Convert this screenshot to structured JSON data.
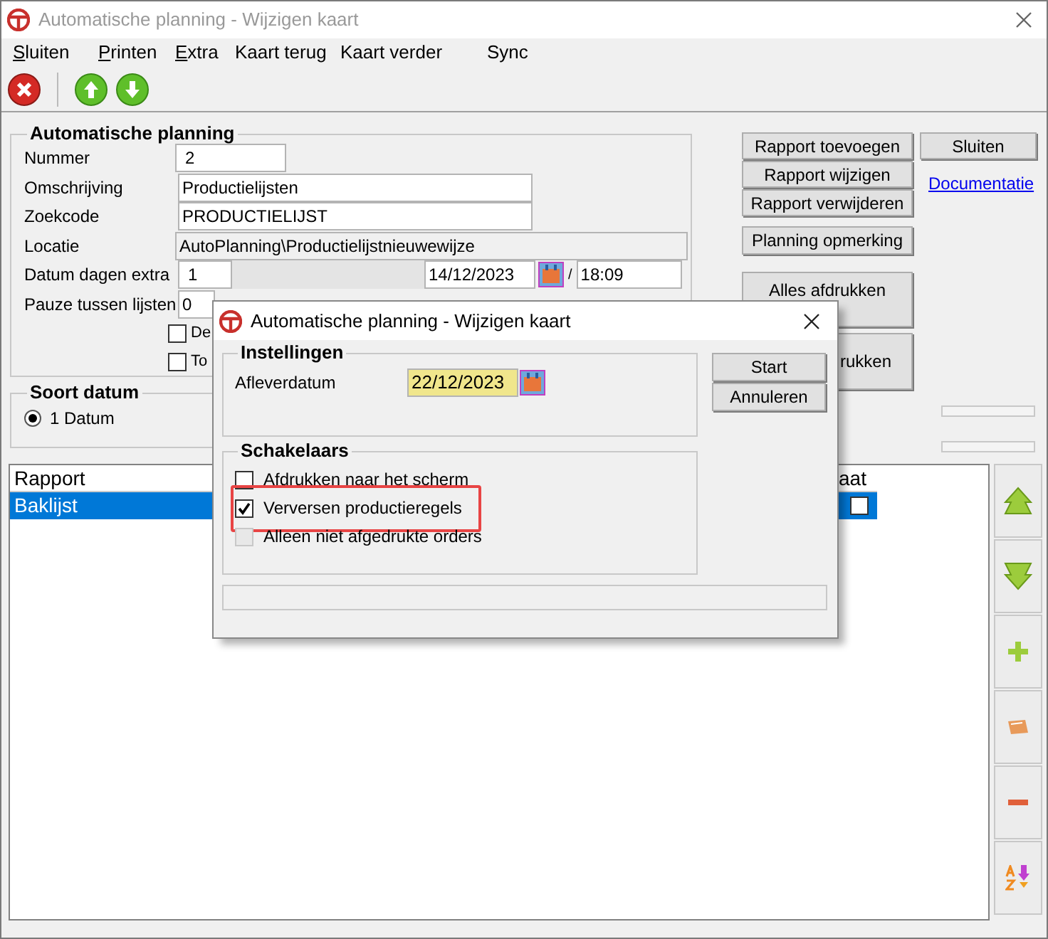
{
  "window": {
    "title": "Automatische planning - Wijzigen kaart"
  },
  "menu": [
    {
      "label": "Sluiten",
      "mnemonic": true
    },
    {
      "label": "Printen",
      "mnemonic": true
    },
    {
      "label": "Extra",
      "mnemonic": true
    },
    {
      "label": "Kaart terug",
      "mnemonic": false
    },
    {
      "label": "Kaart verder",
      "mnemonic": false
    },
    {
      "label": "Sync",
      "mnemonic": false
    }
  ],
  "form": {
    "title": "Automatische planning",
    "fields": [
      {
        "label": "Nummer",
        "value": "2",
        "kind": "short"
      },
      {
        "label": "Omschrijving",
        "value": "Productielijsten",
        "kind": "long"
      },
      {
        "label": "Zoekcode",
        "value": "PRODUCTIELIJST",
        "kind": "long"
      },
      {
        "label": "Locatie",
        "value": "AutoPlanning\\Productielijstnieuwewijze",
        "kind": "readonly"
      },
      {
        "label": "Datum dagen extra",
        "value": "1",
        "kind": "datetime",
        "date": "14/12/2023",
        "separator": "/",
        "time": "18:09"
      },
      {
        "label": "Pauze tussen lijsten",
        "value": "0",
        "kind": "tiny"
      }
    ],
    "checkboxes": [
      {
        "label": "De",
        "checked": false
      },
      {
        "label": "To",
        "checked": false
      }
    ]
  },
  "soort_datum": {
    "title": "Soort datum",
    "options": [
      {
        "label": "1 Datum",
        "selected": true
      }
    ]
  },
  "actions": [
    "Rapport toevoegen",
    "Rapport wijzigen",
    "Rapport verwijderen",
    "Planning opmerking",
    "Alles afdrukken",
    "rukken"
  ],
  "progress": [
    {
      "level": 0
    },
    {
      "level": 0
    }
  ],
  "close_button": "Sluiten",
  "documentation_link": "Documentatie",
  "table": {
    "columns": [
      "Rapport",
      "aat"
    ],
    "rows": [
      {
        "cells": [
          "Baklijst"
        ],
        "checked": false,
        "selected": true
      }
    ]
  },
  "dialog": {
    "title": "Automatische planning - Wijzigen kaart",
    "instellingen": {
      "title": "Instellingen",
      "label": "Afleverdatum",
      "value": "22/12/2023"
    },
    "buttons": [
      "Start",
      "Annuleren"
    ],
    "schakelaars": {
      "title": "Schakelaars",
      "items": [
        {
          "label": "Afdrukken naar het scherm",
          "checked": false,
          "disabled": false,
          "highlighted": false
        },
        {
          "label": "Verversen productieregels",
          "checked": true,
          "disabled": false,
          "highlighted": true
        },
        {
          "label": "Alleen niet afgedrukte orders",
          "checked": false,
          "disabled": true,
          "highlighted": false
        }
      ]
    }
  }
}
